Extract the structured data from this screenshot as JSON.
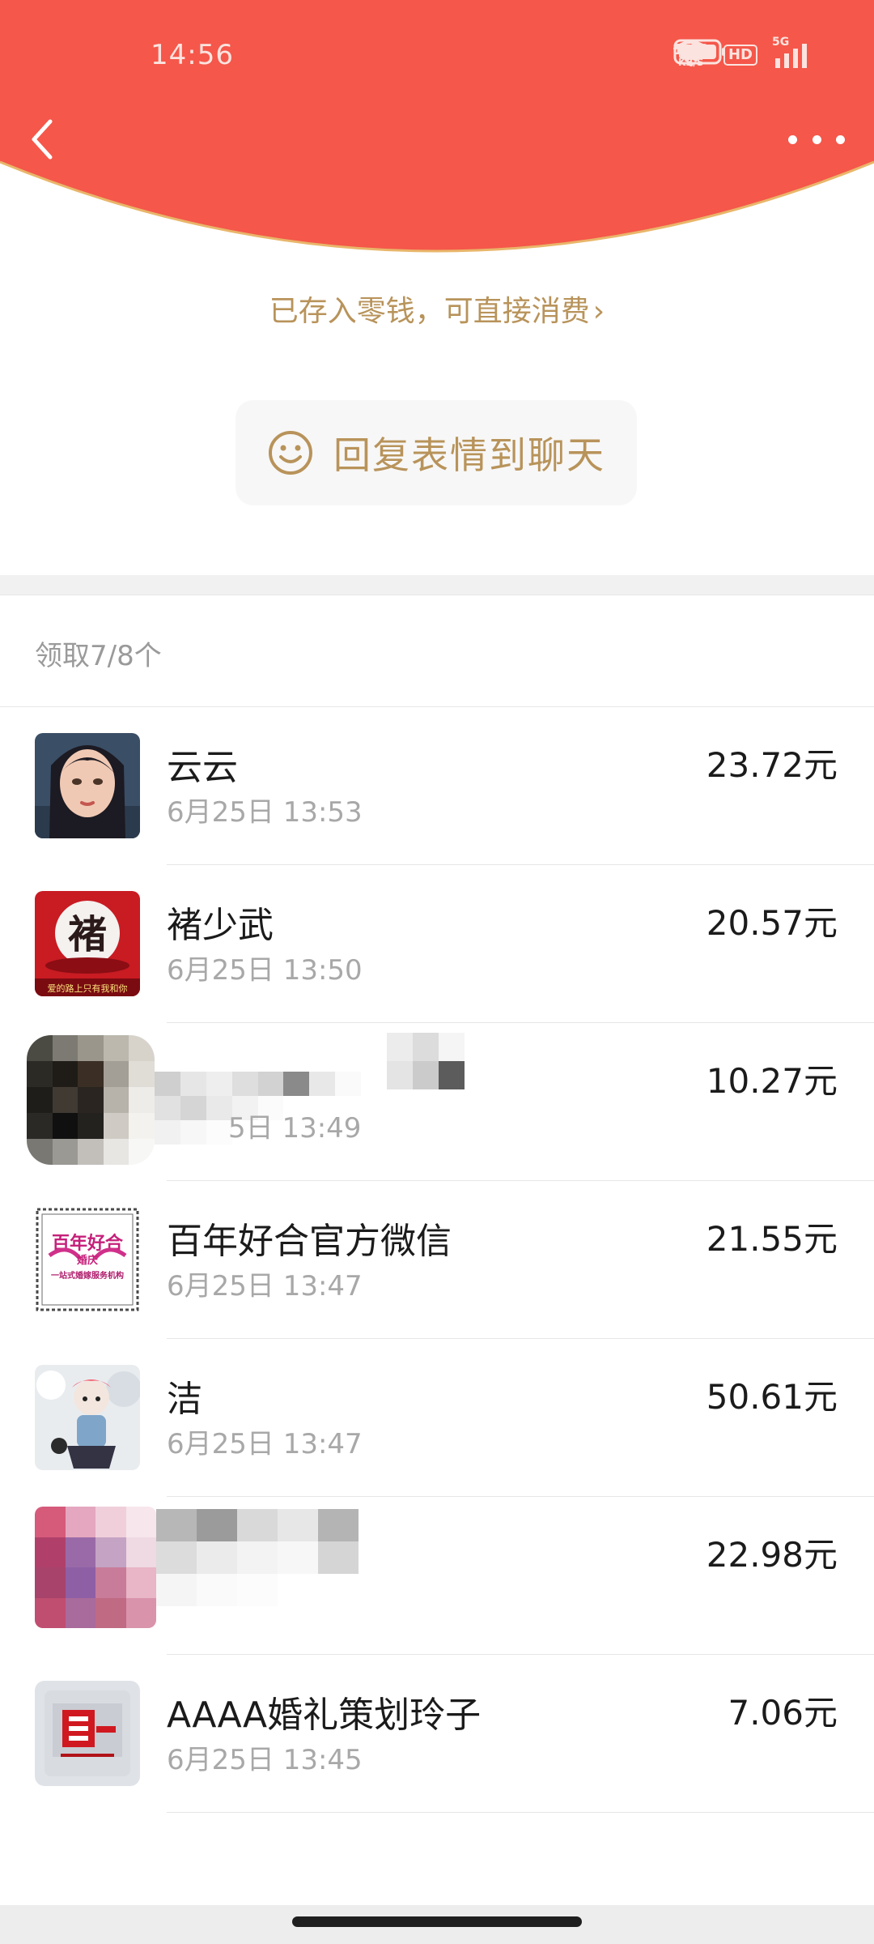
{
  "status_bar": {
    "time": "14:56",
    "net_speed_value": "1.00",
    "net_speed_unit": "KB/S",
    "hd_label": "HD",
    "network_label": "5G"
  },
  "colors": {
    "header_red": "#f5574a",
    "gold": "#b8935a",
    "header_border": "#e9b66a"
  },
  "toolbar": {
    "back_icon": "chevron-left-icon",
    "more_icon": "more-dots-icon"
  },
  "saved_notice": {
    "text": "已存入零钱，可直接消费",
    "chevron": "›"
  },
  "reply_button": {
    "label": "回复表情到聊天",
    "icon": "smiley-icon"
  },
  "claim_summary": "领取7/8个",
  "recipients": [
    {
      "name": "云云",
      "time": "6月25日  13:53",
      "amount": "23.72元"
    },
    {
      "name": "褚少武",
      "time": "6月25日  13:50",
      "amount": "20.57元"
    },
    {
      "name": "",
      "time": "5日  13:49",
      "amount": "10.27元"
    },
    {
      "name": "百年好合官方微信",
      "time": "6月25日  13:47",
      "amount": "21.55元"
    },
    {
      "name": "洁",
      "time": "6月25日  13:47",
      "amount": "50.61元"
    },
    {
      "name": "",
      "time": "",
      "amount": "22.98元"
    },
    {
      "name": "AAAA婚礼策划玲子",
      "time": "6月25日  13:45",
      "amount": "7.06元"
    }
  ],
  "avatar_texts": {
    "chu_char": "褚",
    "chu_caption": "爱的路上只有我和你",
    "bainian_title": "百年好合",
    "bainian_sub": "婚庆",
    "bainian_caption": "一站式婚嫁服务机构"
  }
}
